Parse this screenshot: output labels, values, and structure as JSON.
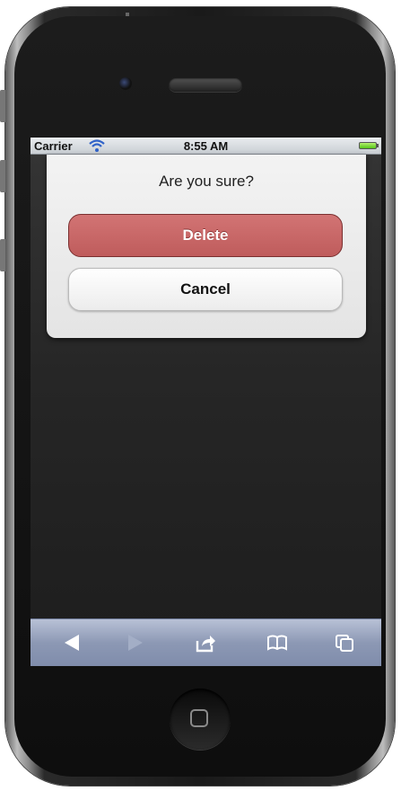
{
  "status_bar": {
    "carrier": "Carrier",
    "time": "8:55 AM"
  },
  "dialog": {
    "title": "Are you sure?",
    "delete_label": "Delete",
    "cancel_label": "Cancel"
  },
  "toolbar": {
    "icons": [
      "back-icon",
      "forward-icon",
      "share-icon",
      "bookmarks-icon",
      "tabs-icon"
    ]
  },
  "colors": {
    "delete_button": "#c96666",
    "toolbar": "#8f9bb7",
    "status_bar": "#d6dadf"
  }
}
